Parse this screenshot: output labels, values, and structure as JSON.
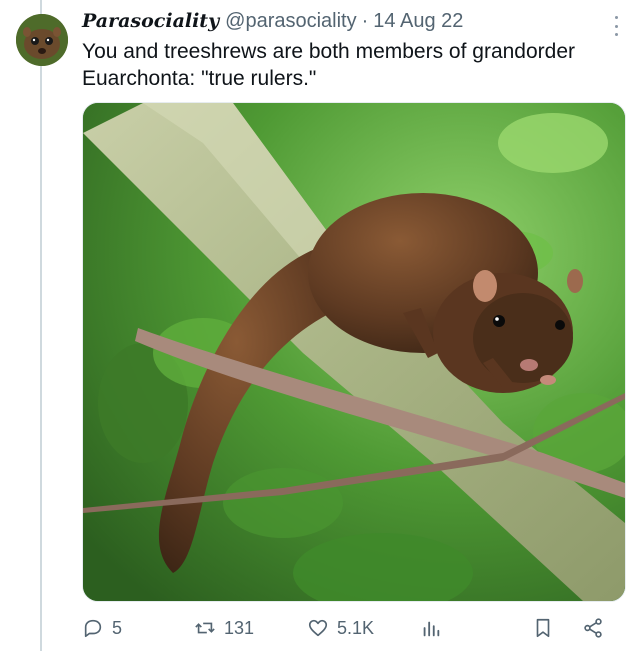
{
  "tweet": {
    "display_name": "Parasociality",
    "handle": "@parasociality",
    "separator": "·",
    "date": "14 Aug 22",
    "text": "You and treeshrews are both members of grandorder Euarchonta: \"true rulers.\"",
    "media": {
      "subject": "treeshrew on a branch"
    }
  },
  "actions": {
    "replies": "5",
    "reposts": "131",
    "likes": "5.1K"
  },
  "icons": {
    "reply": "reply-icon",
    "repost": "repost-icon",
    "like": "heart-icon",
    "views": "analytics-icon",
    "bookmark": "bookmark-icon",
    "share": "share-icon",
    "more": "more-options-icon"
  },
  "colors": {
    "text_primary": "#0f1419",
    "text_secondary": "#536471",
    "thread_line": "#cfd9de"
  }
}
